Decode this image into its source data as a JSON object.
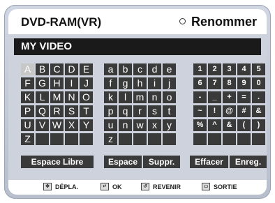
{
  "header": {
    "title": "DVD-RAM(VR)",
    "mode": "Renommer"
  },
  "name_field": {
    "value": "MY VIDEO"
  },
  "keyboard": {
    "upper": [
      [
        "A",
        "B",
        "C",
        "D",
        "E"
      ],
      [
        "F",
        "G",
        "H",
        "I",
        "J"
      ],
      [
        "K",
        "L",
        "M",
        "N",
        "O"
      ],
      [
        "P",
        "Q",
        "R",
        "S",
        "T"
      ],
      [
        "U",
        "V",
        "W",
        "X",
        "Y"
      ],
      [
        "Z",
        "",
        "",
        "",
        ""
      ]
    ],
    "lower": [
      [
        "a",
        "b",
        "c",
        "d",
        "e"
      ],
      [
        "f",
        "g",
        "h",
        "i",
        "j"
      ],
      [
        "k",
        "l",
        "m",
        "n",
        "o"
      ],
      [
        "p",
        "q",
        "r",
        "s",
        "t"
      ],
      [
        "u",
        "n",
        "w",
        "x",
        "y"
      ],
      [
        "z",
        "",
        "",
        "",
        ""
      ]
    ],
    "symbols": [
      [
        "1",
        "2",
        "3",
        "4",
        "5"
      ],
      [
        "6",
        "7",
        "8",
        "9",
        "0"
      ],
      [
        "-",
        "_",
        "+",
        "=",
        "."
      ],
      [
        "~",
        "!",
        "@",
        "#",
        "&"
      ],
      [
        "%",
        "^",
        "&",
        "(",
        ")"
      ],
      [
        "",
        "",
        "",
        "",
        ""
      ]
    ],
    "selected": "A"
  },
  "buttons": {
    "space_free": "Espace Libre",
    "space": "Espace",
    "delete": "Suppr.",
    "clear": "Effacer",
    "save": "Enreg."
  },
  "footer": {
    "move": "DÉPLA.",
    "ok": "OK",
    "back": "REVENIR",
    "exit": "SORTIE"
  }
}
